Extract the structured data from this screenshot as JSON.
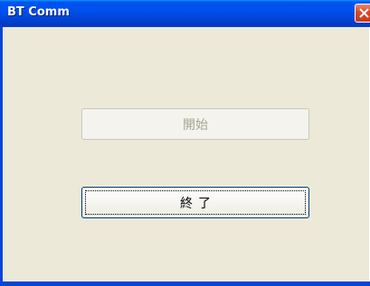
{
  "window": {
    "title": "BT Comm",
    "close_icon": "close-icon"
  },
  "buttons": {
    "start_label": "開始",
    "end_label": "終了"
  },
  "colors": {
    "titlebar": "#0053ee",
    "client_bg": "#ece9d8",
    "close_button": "#d8482a",
    "disabled_text": "#a6a496"
  }
}
